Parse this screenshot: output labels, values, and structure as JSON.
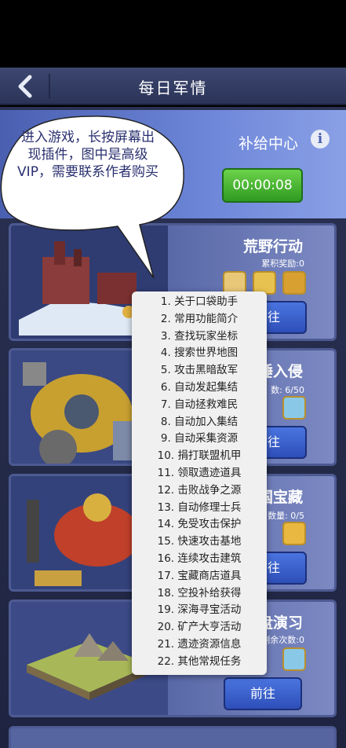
{
  "header": {
    "title": "每日军情"
  },
  "supply": {
    "title": "补给中心",
    "timer": "00:00:08"
  },
  "cards": [
    {
      "title": "荒野行动",
      "subtitle": "累积奖励:0",
      "button": "前往"
    },
    {
      "title": "捶入侵",
      "subtitle": "数: 6/50",
      "button": "前往"
    },
    {
      "title": "国宝藏",
      "subtitle": "数量: 0/5",
      "button": "前往"
    },
    {
      "title": "盘演习",
      "subtitle": "剩余次数:0",
      "button": "前往"
    }
  ],
  "bubble": {
    "text": "进入游戏，长按屏幕出现插件，图中是高级VIP，需要联系作者购买"
  },
  "menu": {
    "items": [
      "1. 关于口袋助手",
      "2. 常用功能简介",
      "3. 查找玩家坐标",
      "4. 搜索世界地图",
      "5. 攻击黑暗敌军",
      "6. 自动发起集结",
      "7. 自动拯救难民",
      "8. 自动加入集结",
      "9. 自动采集资源",
      "10. 捐打联盟机甲",
      "11. 领取遗迹道具",
      "12. 击败战争之源",
      "13. 自动修理士兵",
      "14. 免受攻击保护",
      "15. 快速攻击基地",
      "16. 连续攻击建筑",
      "17. 宝藏商店道具",
      "18. 空投补给获得",
      "19. 深海寻宝活动",
      "20. 矿产大亨活动",
      "21. 遗迹资源信息",
      "22. 其他常规任务"
    ]
  }
}
